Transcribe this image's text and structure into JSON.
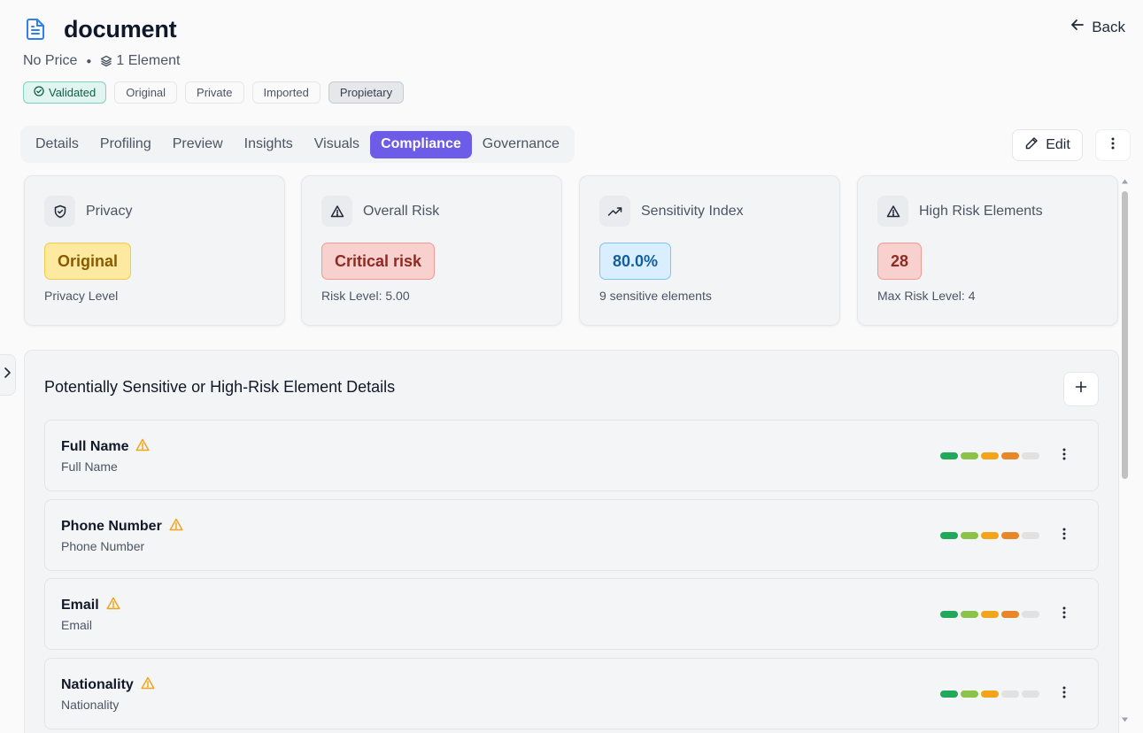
{
  "header": {
    "title": "document",
    "back_label": "Back",
    "price": "No Price",
    "elements": "1 Element"
  },
  "badges": [
    {
      "label": "Validated"
    },
    {
      "label": "Original"
    },
    {
      "label": "Private"
    },
    {
      "label": "Imported"
    },
    {
      "label": "Propietary"
    }
  ],
  "tabs": [
    {
      "label": "Details"
    },
    {
      "label": "Profiling"
    },
    {
      "label": "Preview"
    },
    {
      "label": "Insights"
    },
    {
      "label": "Visuals"
    },
    {
      "label": "Compliance",
      "active": true
    },
    {
      "label": "Governance"
    }
  ],
  "actions": {
    "edit_label": "Edit"
  },
  "cards": [
    {
      "label": "Privacy",
      "value": "Original",
      "sub": "Privacy Level",
      "icon": "shield-check-icon"
    },
    {
      "label": "Overall Risk",
      "value": "Critical risk",
      "sub": "Risk Level: 5.00",
      "icon": "warning-icon"
    },
    {
      "label": "Sensitivity Index",
      "value": "80.0%",
      "sub": "9 sensitive elements",
      "icon": "trending-up-icon"
    },
    {
      "label": "High Risk Elements",
      "value": "28",
      "sub": "Max Risk Level: 4",
      "icon": "warning-icon"
    }
  ],
  "panel": {
    "title": "Potentially Sensitive or High-Risk Element Details",
    "rows": [
      {
        "name": "Full Name",
        "sub": "Full Name",
        "risk_level": 4
      },
      {
        "name": "Phone Number",
        "sub": "Phone Number",
        "risk_level": 4
      },
      {
        "name": "Email",
        "sub": "Email",
        "risk_level": 4
      },
      {
        "name": "Nationality",
        "sub": "Nationality",
        "risk_level": 3
      }
    ]
  },
  "colors": {
    "accent": "#6c5ce7",
    "risk_segments": [
      "#22a85a",
      "#8bc34a",
      "#f2a51a",
      "#e8862a",
      "#e1e1e1"
    ],
    "warning": "#f2a51a"
  }
}
